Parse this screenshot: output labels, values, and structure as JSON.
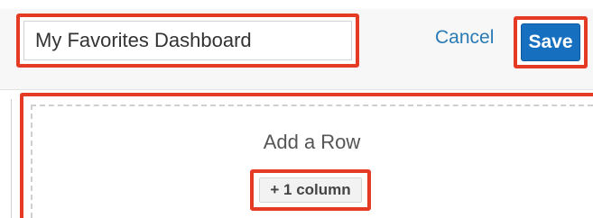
{
  "header": {
    "title_value": "My Favorites Dashboard",
    "cancel_label": "Cancel",
    "save_label": "Save"
  },
  "dashlet_area": {
    "add_row_label": "Add a Row",
    "add_column_label": "+ 1 column"
  },
  "colors": {
    "annotation": "#e53a24",
    "save_button": "#176fc0",
    "link": "#2a7ab5"
  }
}
